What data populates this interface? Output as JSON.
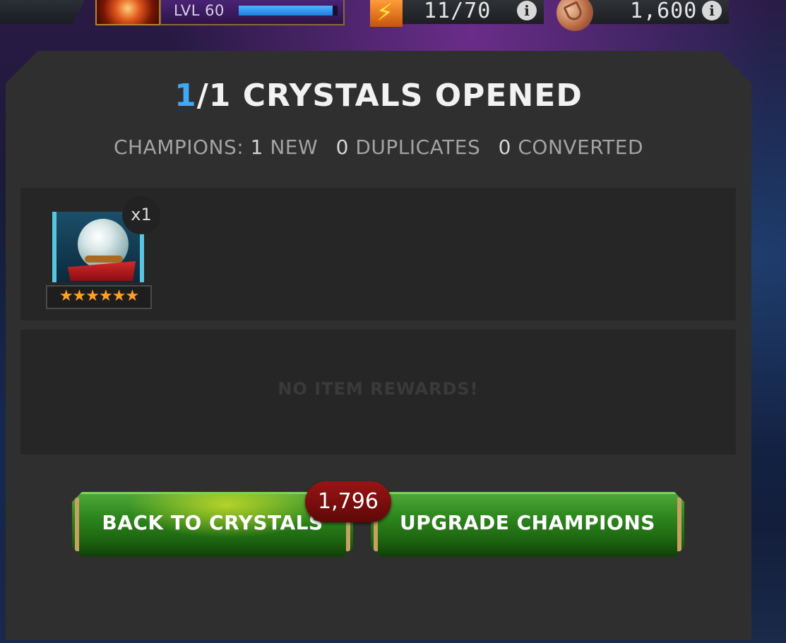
{
  "topbar": {
    "level_label": "LVL 60",
    "xp_fraction": 0.95,
    "energy": "11/70",
    "currency": "1,600"
  },
  "dialog": {
    "title_count": "1",
    "title_rest": "/1 CRYSTALS OPENED",
    "summary": {
      "label": "CHAMPIONS:",
      "new_count": "1",
      "new_label": "NEW",
      "duplicates_count": "0",
      "duplicates_label": "DUPLICATES",
      "converted_count": "0",
      "converted_label": "CONVERTED"
    },
    "reward": {
      "quantity": "x1",
      "stars": "★★★★★★",
      "star_count": 6
    },
    "no_items_text": "NO ITEM REWARDS!"
  },
  "buttons": {
    "back": "BACK TO CRYSTALS",
    "upgrade": "UPGRADE CHAMPIONS",
    "cost": "1,796"
  },
  "colors": {
    "accent_blue": "#3fa9f5",
    "button_green": "#2f8a1f",
    "star_orange": "#ff9f2a",
    "badge_red": "#9a1414"
  }
}
